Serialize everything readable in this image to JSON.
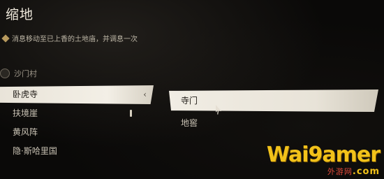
{
  "screen": {
    "title": "缩地",
    "hint": "消息移动至已上香的土地庙，并调息一次"
  },
  "regions": {
    "current": "沙门村",
    "sub_locations": [
      {
        "label": "卧虎寺",
        "selected": true
      },
      {
        "label": "扶境崖",
        "selected": false
      },
      {
        "label": "黄风阵",
        "selected": false
      },
      {
        "label": "隐·斯哈里国",
        "selected": false
      }
    ]
  },
  "shrines": [
    {
      "label": "寺门",
      "selected": true
    },
    {
      "label": "地窖",
      "selected": false
    }
  ],
  "icons": {
    "hint": "diamond-icon",
    "region": "region-marker-icon",
    "expand": "chevron-left-icon",
    "pointer": "cursor-icon"
  },
  "watermark": {
    "main": "Wai9amer",
    "sub": "外游网",
    "domain": ".com"
  },
  "colors": {
    "background": "#0a0908",
    "text": "#d8d2c4",
    "selected_bg": "#f1ede4",
    "watermark_yellow": "#f2c21a",
    "watermark_red": "#e04a3a"
  }
}
